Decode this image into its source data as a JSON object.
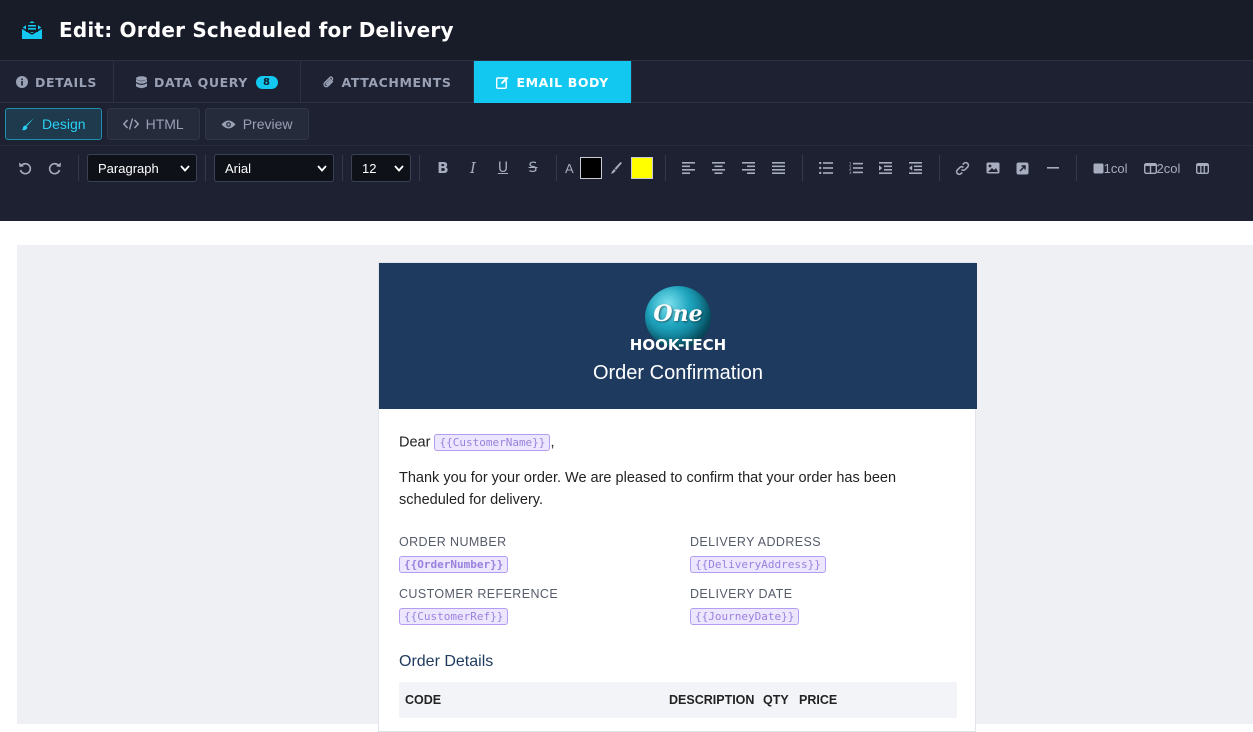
{
  "header": {
    "title": "Edit: Order Scheduled for Delivery"
  },
  "tabs": [
    {
      "label": "DETAILS"
    },
    {
      "label": "DATA QUERY",
      "badge": "8"
    },
    {
      "label": "ATTACHMENTS"
    },
    {
      "label": "EMAIL BODY"
    }
  ],
  "modes": {
    "design": "Design",
    "html": "HTML",
    "preview": "Preview"
  },
  "toolbar": {
    "block_format": "Paragraph",
    "font_family": "Arial",
    "font_size": "12",
    "text_color": "#000000",
    "highlight_color": "#ffff00",
    "col1": "1col",
    "col2": "2col"
  },
  "email": {
    "logo_mark": "One",
    "logo_text": "HOOK-TECH",
    "title": "Order Confirmation",
    "greeting": "Dear",
    "customer_tag": "{{CustomerName}}",
    "greeting_end": ",",
    "intro": "Thank you for your order. We are pleased to confirm that your order has been scheduled for delivery.",
    "fields": [
      {
        "label": "ORDER NUMBER",
        "tag": "{{OrderNumber}}"
      },
      {
        "label": "DELIVERY ADDRESS",
        "tag": "{{DeliveryAddress}}"
      },
      {
        "label": "CUSTOMER REFERENCE",
        "tag": "{{CustomerRef}}"
      },
      {
        "label": "DELIVERY DATE",
        "tag": "{{JourneyDate}}"
      }
    ],
    "details_heading": "Order Details",
    "table_headers": [
      "CODE",
      "DESCRIPTION",
      "QTY",
      "PRICE"
    ]
  },
  "colors": {
    "accent": "#12c8f0",
    "header_bg": "#181b28",
    "email_header": "#1e3a5f"
  }
}
